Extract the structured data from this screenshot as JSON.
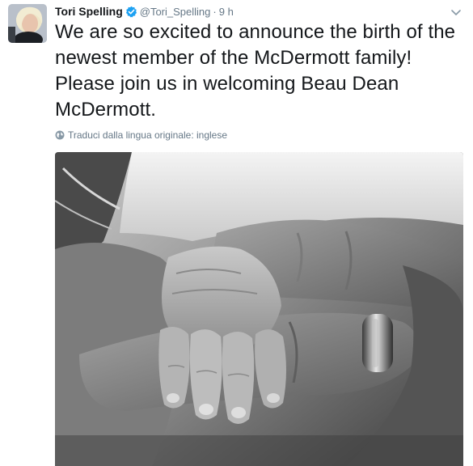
{
  "tweet": {
    "display_name": "Tori Spelling",
    "handle": "@Tori_Spelling",
    "separator": "·",
    "time": "9 h",
    "text": "We are so excited to announce the birth of the newest member of the McDermott family! Please join us in welcoming Beau Dean McDermott.",
    "translate_label": "Traduci dalla lingua originale: inglese"
  },
  "icons": {
    "verified": "verified-badge-icon",
    "caret": "chevron-down-icon",
    "globe": "globe-icon"
  },
  "colors": {
    "verified_blue": "#1da1f2",
    "name_text": "#14171a",
    "secondary_text": "#657786"
  }
}
